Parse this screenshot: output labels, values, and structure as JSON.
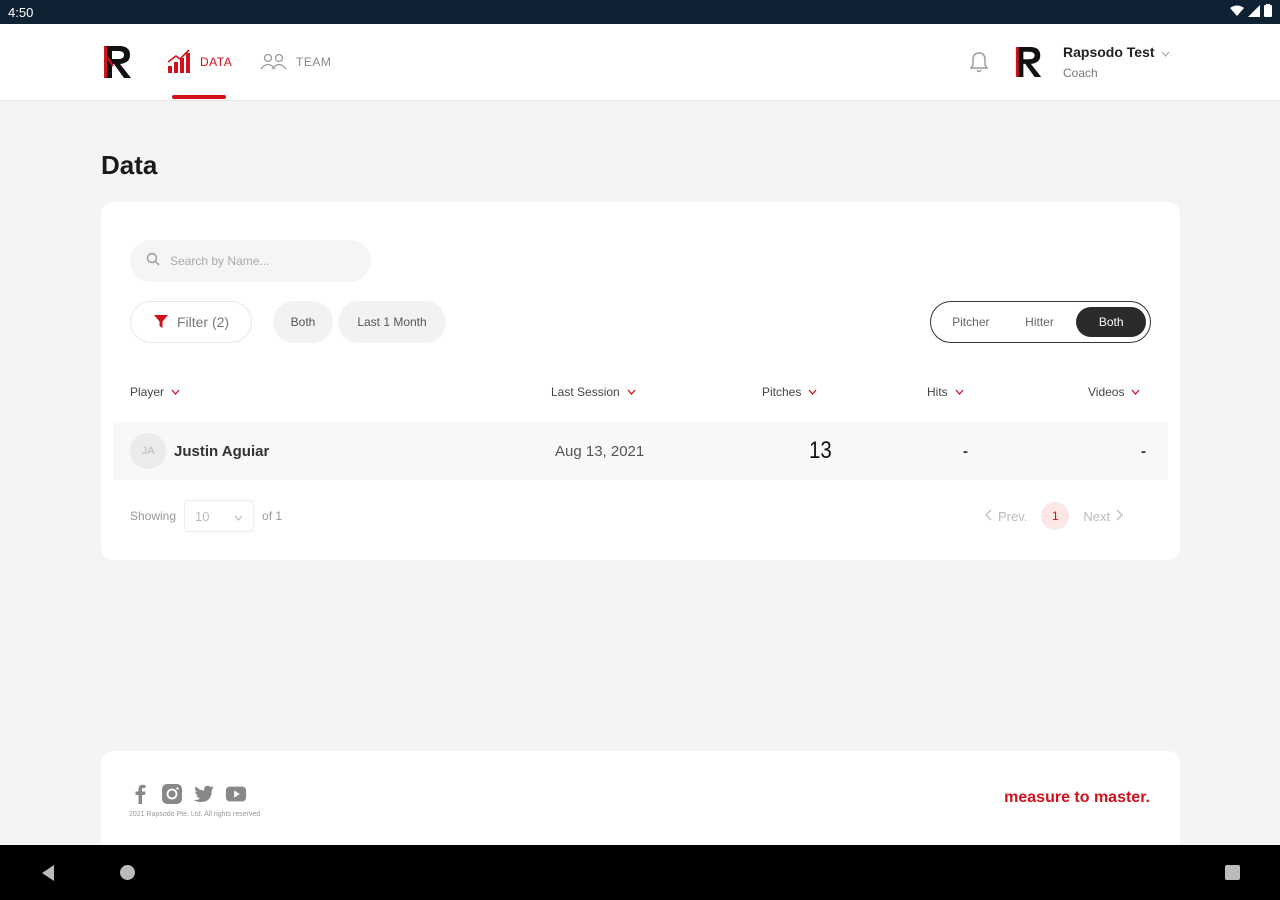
{
  "status_bar": {
    "time": "4:50"
  },
  "header": {
    "nav": {
      "data_label": "DATA",
      "team_label": "TEAM"
    },
    "user": {
      "name": "Rapsodo Test",
      "role": "Coach"
    }
  },
  "page": {
    "title": "Data"
  },
  "search": {
    "placeholder": "Search by Name..."
  },
  "filters": {
    "filter_label": "Filter (2)",
    "chip_both": "Both",
    "chip_period": "Last 1 Month"
  },
  "toggle": {
    "pitcher": "Pitcher",
    "hitter": "Hitter",
    "both": "Both",
    "selected": "Both"
  },
  "table": {
    "headers": {
      "player": "Player",
      "last_session": "Last Session",
      "pitches": "Pitches",
      "hits": "Hits",
      "videos": "Videos"
    },
    "rows": [
      {
        "initials": "JA",
        "name": "Justin Aguiar",
        "last_session": "Aug 13, 2021",
        "pitches": "13",
        "hits": "-",
        "videos": "-"
      }
    ]
  },
  "pagination": {
    "showing_label": "Showing",
    "page_size": "10",
    "of_label": "of 1",
    "prev_label": "Prev.",
    "current_page": "1",
    "next_label": "Next"
  },
  "footer": {
    "copyright": "2021 Rapsodo Pte. Ltd. All rights reserved",
    "tagline": "measure to master."
  },
  "colors": {
    "accent": "#d0121b",
    "dark": "#2b2b2b",
    "status_bar": "#0e2233"
  }
}
